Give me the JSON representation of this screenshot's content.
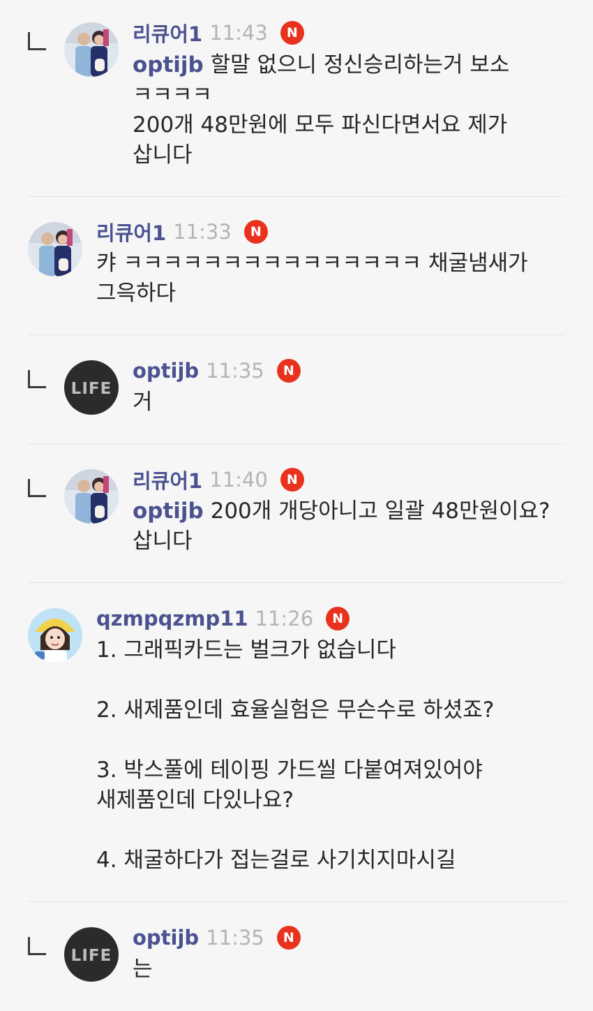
{
  "comments": [
    {
      "is_reply": true,
      "avatar": "couple-photo-avatar",
      "nickname": "리큐어1",
      "time": "11:43",
      "badge": "N",
      "mention": "optijb",
      "text": " 할말 없으니 정신승리하는거 보소\nㅋㅋㅋㅋ\n200개 48만원에 모두 파신다면서요 제가\n삽니다"
    },
    {
      "is_reply": false,
      "avatar": "couple-photo-avatar",
      "nickname": "리큐어1",
      "time": "11:33",
      "badge": "N",
      "mention": "",
      "text": "캬 ㅋㅋㅋㅋㅋㅋㅋㅋㅋㅋㅋㅋㅋㅋㅋ 채굴냄새가\n그윽하다"
    },
    {
      "is_reply": true,
      "avatar": "life-logo-avatar",
      "avatar_text": "LIFE",
      "nickname": "optijb",
      "time": "11:35",
      "badge": "N",
      "mention": "",
      "text": "거"
    },
    {
      "is_reply": true,
      "avatar": "couple-photo-avatar",
      "nickname": "리큐어1",
      "time": "11:40",
      "badge": "N",
      "mention": "optijb",
      "text": " 200개 개당아니고 일괄 48만원이요?\n삽니다"
    },
    {
      "is_reply": false,
      "avatar": "cartoon-girl-avatar",
      "nickname": "qzmpqzmp11",
      "time": "11:26",
      "badge": "N",
      "mention": "",
      "text": "1. 그래픽카드는 벌크가 없습니다\n\n2. 새제품인데 효율실험은 무슨수로 하셨죠?\n\n3. 박스풀에 테이핑 가드씰 다붙여져있어야\n새제품인데 다있나요?\n\n4. 채굴하다가 접는걸로 사기치지마시길"
    },
    {
      "is_reply": true,
      "avatar": "life-logo-avatar",
      "avatar_text": "LIFE",
      "nickname": "optijb",
      "time": "11:35",
      "badge": "N",
      "mention": "",
      "text": "는"
    }
  ],
  "colors": {
    "background": "#f6f6f6",
    "nickname": "#4a5290",
    "time": "#b4b4b4",
    "badge": "#e8321e",
    "text": "#262626"
  }
}
